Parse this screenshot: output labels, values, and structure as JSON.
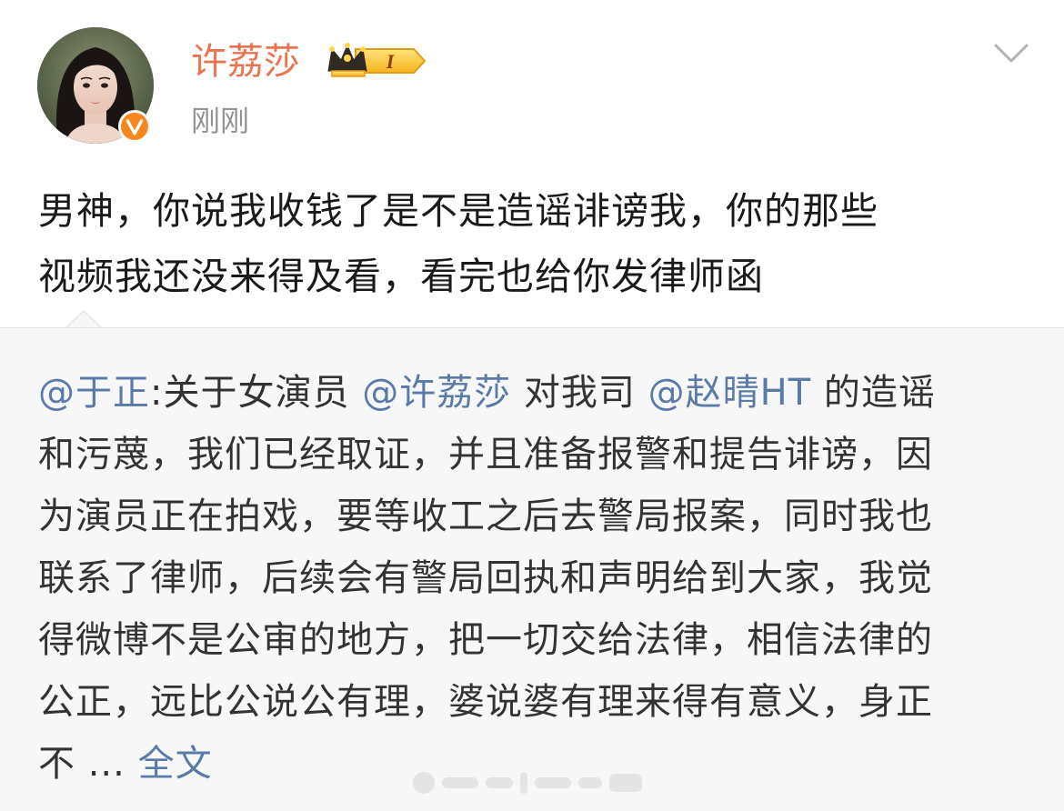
{
  "post": {
    "username": "许荔莎",
    "vip_level": "I",
    "timestamp": "刚刚",
    "text_lines": [
      "男神，你说我收钱了是不是造谣诽谤我，你的那些",
      "视频我还没来得及看，看完也给你发律师函"
    ]
  },
  "repost": {
    "author_mention": "@于正",
    "lines": {
      "l1_a": ":关于女演员 ",
      "l1_mention1": "@许荔莎",
      "l1_b": " 对我司 ",
      "l1_mention2": "@赵晴HT",
      "l1_c": " 的造谣",
      "l2": "和污蔑，我们已经取证，并且准备报警和提告诽谤，因",
      "l3": "为演员正在拍戏，要等收工之后去警局报案，同时我也",
      "l4": "联系了律师，后续会有警局回执和声明给到大家，我觉",
      "l5": "得微博不是公审的地方，把一切交给法律，相信法律的",
      "l6": "公正，远比公说公有理，婆说婆有理来得有意义，身正",
      "l7": "不 ... "
    },
    "fulltext_label": "全文"
  },
  "colors": {
    "username": "#eb7350",
    "mention": "#5a7ba8",
    "timestamp": "#939393",
    "repost_bg": "#f7f7f7"
  },
  "icons": {
    "verified": "verified-v-icon",
    "vip": "crown-vip-icon",
    "more": "chevron-down-icon"
  }
}
